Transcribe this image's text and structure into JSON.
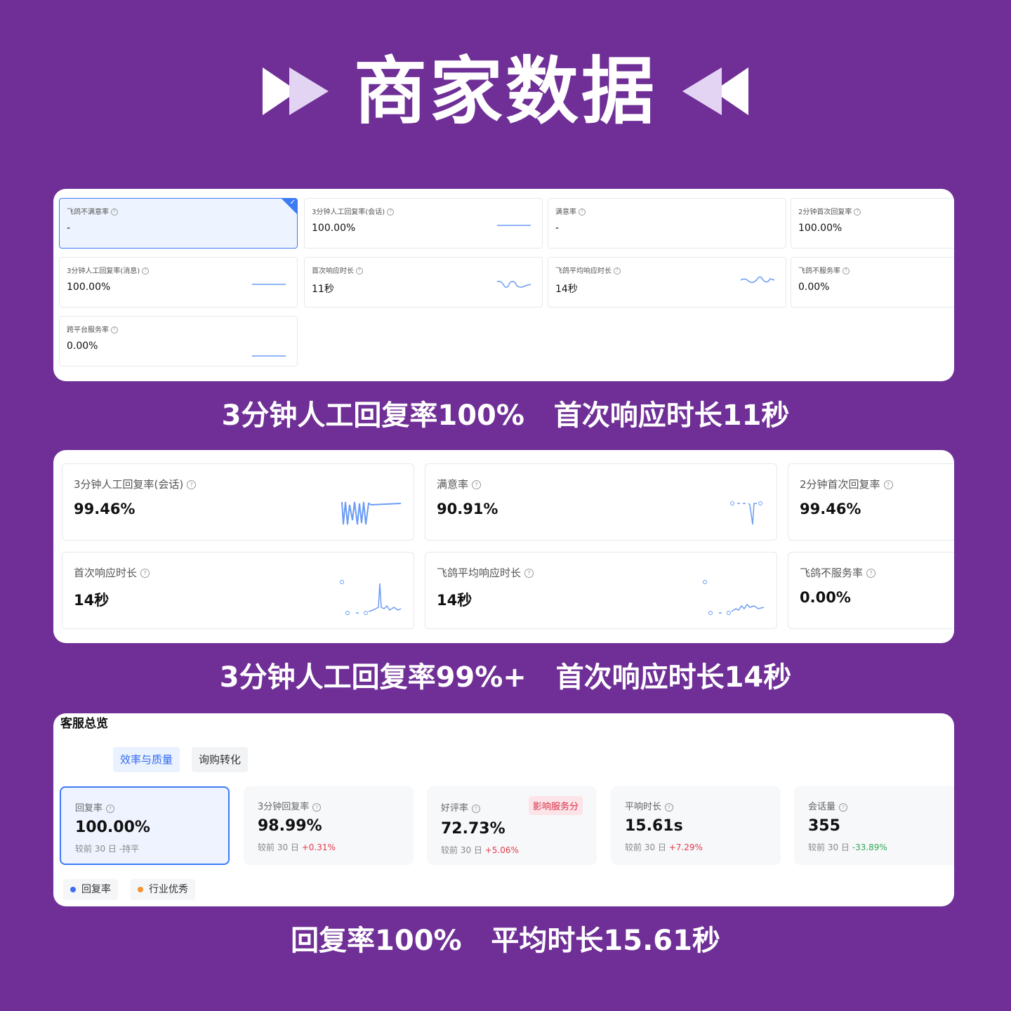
{
  "header": {
    "title": "商家数据"
  },
  "panel1": {
    "cards": [
      {
        "label": "飞鸽不满意率",
        "value": "-"
      },
      {
        "label": "3分钟人工回复率(会话)",
        "value": "100.00%"
      },
      {
        "label": "满意率",
        "value": "-"
      },
      {
        "label": "2分钟首次回复率",
        "value": "100.00%"
      },
      {
        "label": "3分钟人工回复率(消息)",
        "value": "100.00%"
      },
      {
        "label": "首次响应时长",
        "value": "11秒"
      },
      {
        "label": "飞鸽平均响应时长",
        "value": "14秒"
      },
      {
        "label": "飞鸽不服务率",
        "value": "0.00%"
      },
      {
        "label": "跨平台服务率",
        "value": "0.00%"
      }
    ]
  },
  "caption1": "3分钟人工回复率100%   首次响应时长11秒",
  "panel2": {
    "cards": [
      {
        "label": "3分钟人工回复率(会话)",
        "value": "99.46%"
      },
      {
        "label": "满意率",
        "value": "90.91%"
      },
      {
        "label": "2分钟首次回复率",
        "value": "99.46%"
      },
      {
        "label": "首次响应时长",
        "value": "14秒"
      },
      {
        "label": "飞鸽平均响应时长",
        "value": "14秒"
      },
      {
        "label": "飞鸽不服务率",
        "value": "0.00%"
      }
    ]
  },
  "caption2": "3分钟人工回复率99%+   首次响应时长14秒",
  "panel3": {
    "title": "客服总览",
    "tabs": [
      "效率与质量",
      "询购转化"
    ],
    "cards": [
      {
        "label": "回复率",
        "value": "100.00%",
        "cmp_prefix": "较前 30 日",
        "cmp": "-持平"
      },
      {
        "label": "3分钟回复率",
        "value": "98.99%",
        "cmp_prefix": "较前 30 日",
        "cmp": "+0.31%"
      },
      {
        "label": "好评率",
        "value": "72.73%",
        "cmp_prefix": "较前 30 日",
        "cmp": "+5.06%",
        "badge": "影响服务分"
      },
      {
        "label": "平响时长",
        "value": "15.61s",
        "cmp_prefix": "较前 30 日",
        "cmp": "+7.29%"
      },
      {
        "label": "会话量",
        "value": "355",
        "cmp_prefix": "较前 30 日",
        "cmp": "-33.89%"
      }
    ],
    "legend": [
      {
        "label": "回复率",
        "color": "#3d6cf0"
      },
      {
        "label": "行业优秀",
        "color": "#f5922f"
      }
    ]
  },
  "caption3": "回复率100%   平均时长15.61秒",
  "colors": {
    "background": "#6f2f96",
    "accent": "#3d7bf5",
    "up": "#e5394a",
    "down": "#2eaa55"
  }
}
